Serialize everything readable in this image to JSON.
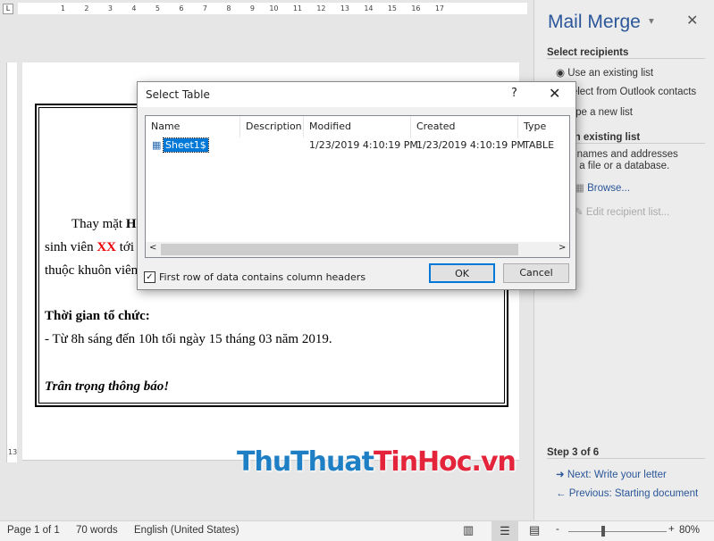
{
  "ruler": {
    "ticks": [
      "",
      "1",
      "2",
      "3",
      "4",
      "5",
      "6",
      "7",
      "8",
      "9",
      "10",
      "11",
      "12",
      "13",
      "14",
      "15",
      "16",
      "17"
    ],
    "vertical_label": "13"
  },
  "document": {
    "line1_a": "Thay mặt ",
    "line1_b": "H",
    "line2_a": "sinh viên ",
    "line2_red": "XX",
    "line2_b": " tới",
    "line3": "thuộc khuôn viên",
    "time_heading": "Thời gian tổ chức:",
    "time_detail": "- Từ 8h sáng đến 10h tối ngày 15 tháng 03 năm 2019.",
    "closing": "Trân trọng thông báo!"
  },
  "mail_merge": {
    "title": "Mail Merge",
    "select_recipients": "Select recipients",
    "options": [
      "Use an existing list",
      "Select from Outlook contacts",
      "Type a new list"
    ],
    "selected_option": "Use an existing list",
    "existing_list_heading": "Use an existing list",
    "existing_list_desc1": "Use names and addresses",
    "existing_list_desc2": "from a file or a database.",
    "browse": "Browse...",
    "edit_list": "Edit recipient list...",
    "step": "Step 3 of 6",
    "next": "Next: Write your letter",
    "previous": "Previous: Starting document"
  },
  "dialog": {
    "title": "Select Table",
    "help": "?",
    "columns": [
      "Name",
      "Description",
      "Modified",
      "Created",
      "Type"
    ],
    "rows": [
      {
        "name": "Sheet1$",
        "description": "",
        "modified": "1/23/2019 4:10:19 PM",
        "created": "1/23/2019 4:10:19 PM",
        "type": "TABLE"
      }
    ],
    "checkbox_label": "First row of data contains column headers",
    "checkbox_checked": true,
    "ok": "OK",
    "cancel": "Cancel"
  },
  "status": {
    "page": "Page 1 of 1",
    "words": "70 words",
    "language": "English (United States)",
    "zoom": "80%",
    "zoom_minus": "-",
    "zoom_plus": "+"
  },
  "watermark": {
    "part1": "ThuThuat",
    "part2": "TinHoc.vn",
    "color1": "#1e7fc4",
    "color2": "#e3243b"
  }
}
